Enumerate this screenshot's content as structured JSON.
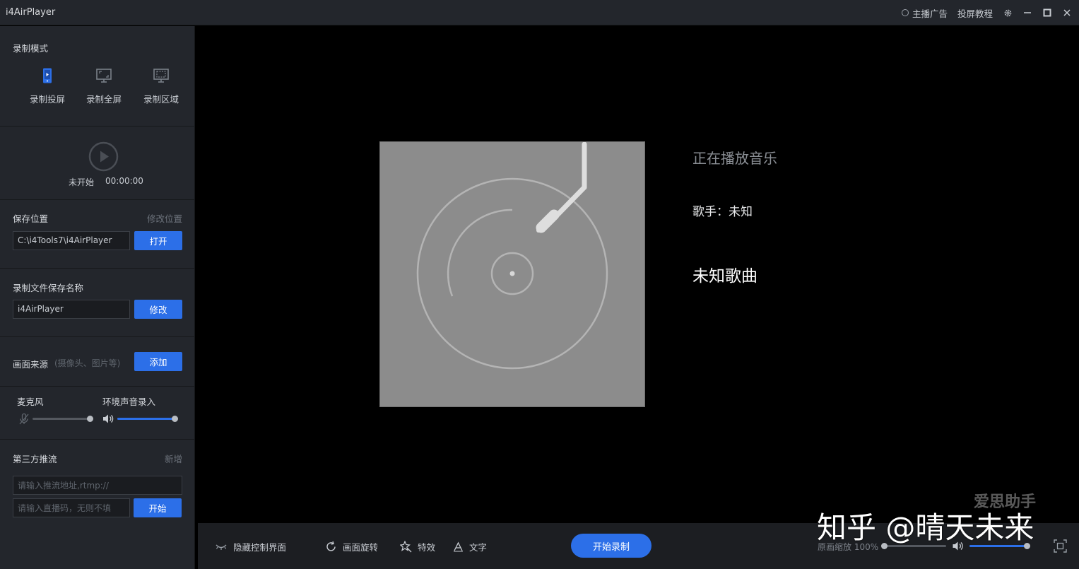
{
  "app": {
    "title": "i4AirPlayer"
  },
  "titlebar": {
    "ad_label": "主播广告",
    "tutorial_label": "投屏教程"
  },
  "sidebar": {
    "record_mode": {
      "title": "录制模式",
      "modes": [
        {
          "label": "录制投屏",
          "icon": "phone-screen-icon",
          "active": true
        },
        {
          "label": "录制全屏",
          "icon": "monitor-fullscreen-icon",
          "active": false
        },
        {
          "label": "录制区域",
          "icon": "monitor-region-icon",
          "active": false
        }
      ]
    },
    "status": {
      "state": "未开始",
      "time": "00:00:00"
    },
    "save_location": {
      "title": "保存位置",
      "change_link": "修改位置",
      "path": "C:\\i4Tools7\\i4AirPlayer",
      "open_button": "打开"
    },
    "file_name": {
      "title": "录制文件保存名称",
      "value": "i4AirPlayer",
      "modify_button": "修改"
    },
    "source": {
      "title": "画面来源",
      "hint": "(摄像头、图片等)",
      "add_button": "添加"
    },
    "audio": {
      "mic_label": "麦克风",
      "mic_level": 1.0,
      "ambient_label": "环境声音录入",
      "ambient_level": 1.0
    },
    "stream": {
      "title": "第三方推流",
      "add_link": "新增",
      "url_placeholder": "请输入推流地址,rtmp://",
      "code_placeholder": "请输入直播码，无则不填",
      "start_button": "开始"
    }
  },
  "player": {
    "now_playing": "正在播放音乐",
    "artist_label": "歌手：",
    "artist_value": "未知",
    "song": "未知歌曲"
  },
  "bottombar": {
    "hide_controls": "隐藏控制界面",
    "rotate": "画面旋转",
    "effects": "特效",
    "text": "文字",
    "record": "开始录制",
    "zoom_label": "原画缩放",
    "zoom_value": "100%",
    "zoom_level": 0.0,
    "volume_level": 1.0
  },
  "watermark": {
    "logo": "爱思助手",
    "text": "知乎 @晴天未来"
  },
  "colors": {
    "accent": "#2c6fe8",
    "sidebar_bg": "#23262c",
    "main_bg": "#000000"
  }
}
